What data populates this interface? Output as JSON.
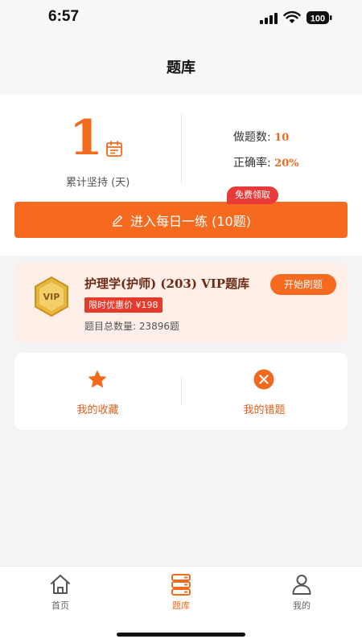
{
  "status_bar": {
    "time": "6:57",
    "battery": "100",
    "icons": [
      "signal-icon",
      "wifi-icon",
      "battery-icon"
    ]
  },
  "nav": {
    "title": "题库"
  },
  "stats": {
    "streak_days": "1",
    "streak_label": "累计坚持 (天)",
    "done_label": "做题数: ",
    "done_value": "10",
    "accuracy_label": "正确率: ",
    "accuracy_value": "20%"
  },
  "practice": {
    "badge": "免费领取",
    "label": "进入每日一练 (10题)",
    "icon": "pencil-icon"
  },
  "vip_bank": {
    "badge_text": "VIP",
    "title": "护理学(护师) (203) VIP题库",
    "promo": "限时优惠价 ¥198",
    "count": "题目总数量: 23896题",
    "start_label": "开始刷题"
  },
  "shortcuts": [
    {
      "label": "我的收藏",
      "icon": "star-icon"
    },
    {
      "label": "我的错题",
      "icon": "wrong-answer-icon"
    }
  ],
  "tabs": [
    {
      "label": "首页",
      "icon": "home-icon",
      "active": false
    },
    {
      "label": "题库",
      "icon": "question-bank-icon",
      "active": true
    },
    {
      "label": "我的",
      "icon": "profile-icon",
      "active": false
    }
  ],
  "colors": {
    "accent": "#f56a1f",
    "badge_red": "#e93a3a",
    "vip_card_bg": "#fdeee8",
    "vip_title": "#6a2b14",
    "gold": "#e8b53c"
  }
}
